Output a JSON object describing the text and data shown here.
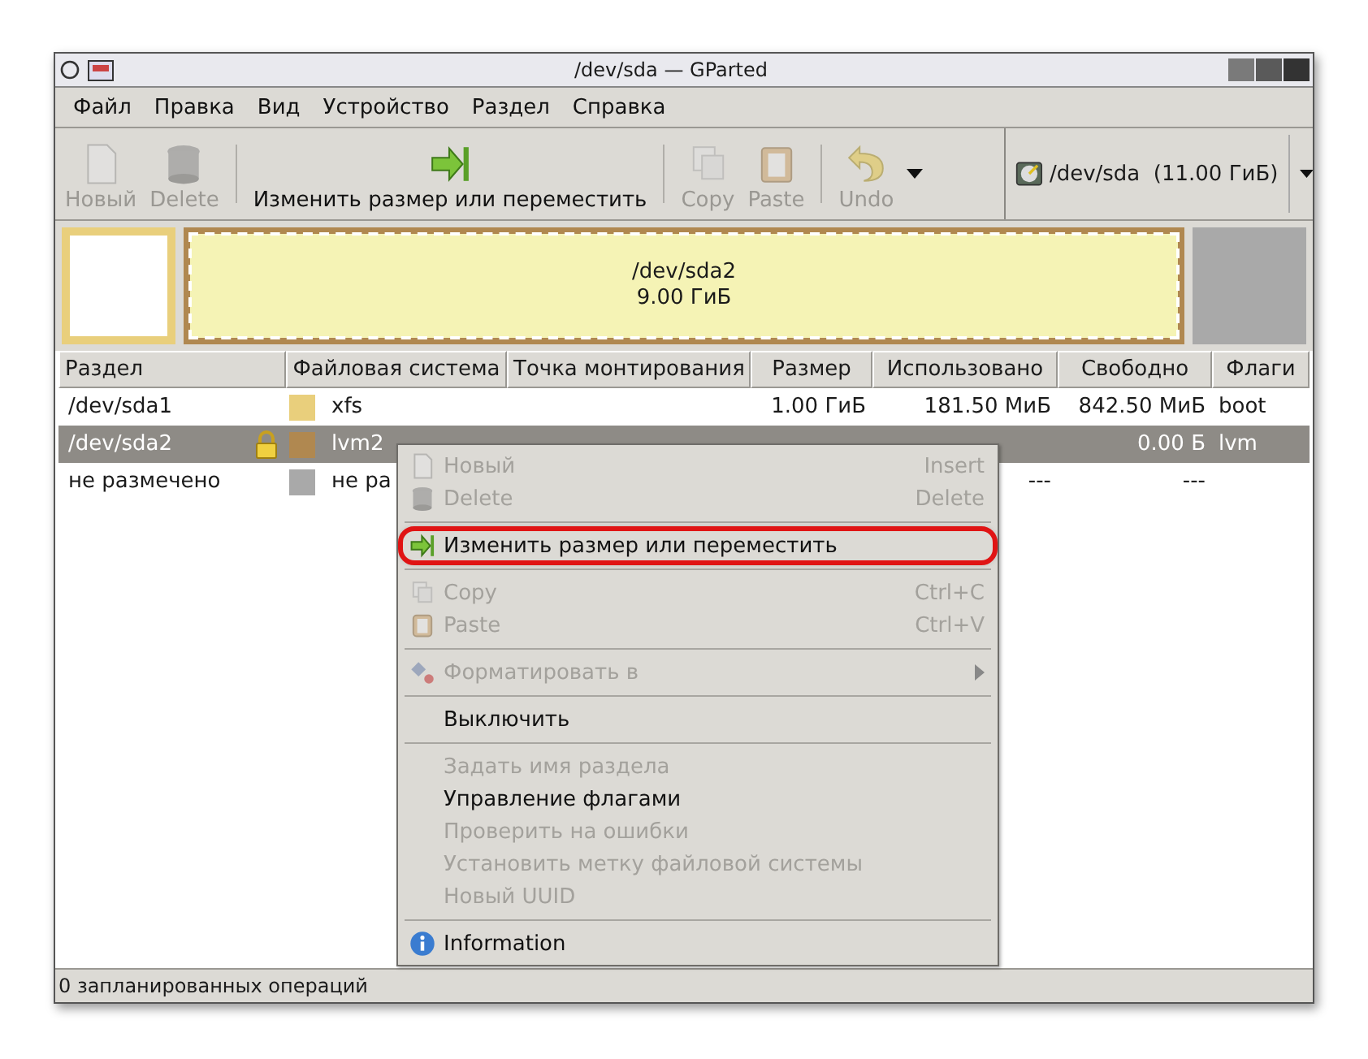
{
  "window": {
    "title": "/dev/sda — GParted"
  },
  "menubar": [
    "Файл",
    "Правка",
    "Вид",
    "Устройство",
    "Раздел",
    "Справка"
  ],
  "toolbar": {
    "items": [
      {
        "kind": "new",
        "label": "Новый",
        "disabled": true
      },
      {
        "kind": "delete",
        "label": "Delete",
        "disabled": true
      },
      {
        "kind": "separator"
      },
      {
        "kind": "resize",
        "label": "Изменить размер или переместить",
        "disabled": false
      },
      {
        "kind": "separator"
      },
      {
        "kind": "copy",
        "label": "Copy",
        "disabled": true
      },
      {
        "kind": "paste",
        "label": "Paste",
        "disabled": true
      },
      {
        "kind": "separator"
      },
      {
        "kind": "undo",
        "label": "Undo",
        "disabled": true
      },
      {
        "kind": "dropdown"
      }
    ],
    "device": "/dev/sda  (11.00 ГиБ)"
  },
  "disk_map": {
    "partitions": [
      {
        "kind": "partition",
        "color": "#e9cf7c",
        "selected": false
      },
      {
        "kind": "partition",
        "color": "#b08850",
        "selected": true,
        "name": "/dev/sda2",
        "size": "9.00 ГиБ"
      },
      {
        "kind": "unallocated",
        "color": "#a9a9a9",
        "selected": false
      }
    ]
  },
  "table": {
    "columns": [
      "Раздел",
      "Файловая система",
      "Точка монтирования",
      "Размер",
      "Использовано",
      "Свободно",
      "Флаги"
    ],
    "rows": [
      {
        "partition": "/dev/sda1",
        "locked": false,
        "color": "#e9cf7c",
        "filesystem": "xfs",
        "size": "1.00 ГиБ",
        "used": "181.50 МиБ",
        "free": "842.50 МиБ",
        "flags": "boot",
        "selected": false
      },
      {
        "partition": "/dev/sda2",
        "locked": true,
        "color": "#b08850",
        "filesystem": "lvm2",
        "free": "0.00 Б",
        "flags": "lvm",
        "selected": true
      },
      {
        "partition": "не размечено",
        "locked": false,
        "color": "#a9a9a9",
        "filesystem": "не ра",
        "used": "---",
        "free": "---",
        "selected": false
      }
    ]
  },
  "context_menu": {
    "items": [
      {
        "kind": "new",
        "label": "Новый",
        "shortcut": "Insert",
        "disabled": true,
        "highlighted": false
      },
      {
        "kind": "delete",
        "label": "Delete",
        "shortcut": "Delete",
        "disabled": true,
        "highlighted": false
      },
      {
        "kind": "separator"
      },
      {
        "kind": "resize",
        "label": "Изменить размер или переместить",
        "disabled": false,
        "highlighted": true
      },
      {
        "kind": "separator"
      },
      {
        "kind": "copy",
        "label": "Copy",
        "shortcut": "Ctrl+C",
        "disabled": true,
        "highlighted": false
      },
      {
        "kind": "paste",
        "label": "Paste",
        "shortcut": "Ctrl+V",
        "disabled": true,
        "highlighted": false
      },
      {
        "kind": "separator"
      },
      {
        "kind": "format",
        "label": "Форматировать в",
        "disabled": true,
        "submenu": true,
        "highlighted": false
      },
      {
        "kind": "separator"
      },
      {
        "kind": "item",
        "label": "Выключить",
        "disabled": false,
        "highlighted": false
      },
      {
        "kind": "separator"
      },
      {
        "kind": "item",
        "label": "Задать имя раздела",
        "disabled": true,
        "highlighted": false
      },
      {
        "kind": "item",
        "label": "Управление флагами",
        "disabled": false,
        "highlighted": false
      },
      {
        "kind": "item",
        "label": "Проверить на ошибки",
        "disabled": true,
        "highlighted": false
      },
      {
        "kind": "item",
        "label": "Установить метку файловой системы",
        "disabled": true,
        "highlighted": false
      },
      {
        "kind": "item",
        "label": "Новый UUID",
        "disabled": true,
        "highlighted": false
      },
      {
        "kind": "separator"
      },
      {
        "kind": "info",
        "label": "Information",
        "disabled": false,
        "highlighted": false
      }
    ]
  },
  "status_bar": "0 запланированных операций"
}
